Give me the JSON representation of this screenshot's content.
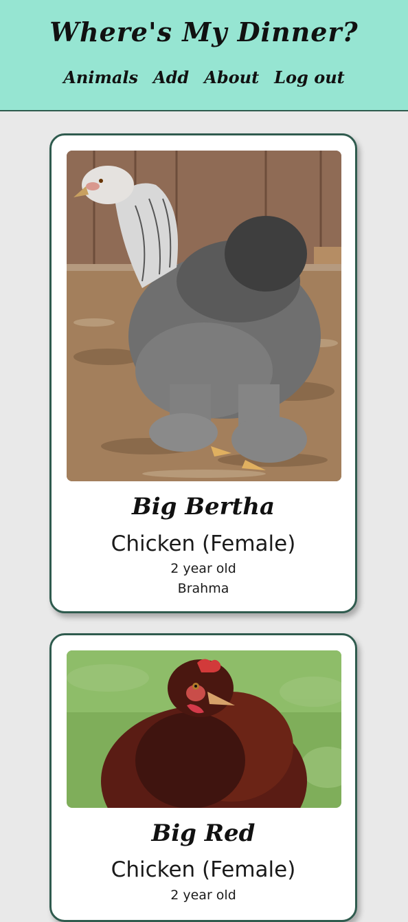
{
  "header": {
    "title": "Where's My Dinner?",
    "nav": [
      "Animals",
      "Add",
      "About",
      "Log out"
    ]
  },
  "animals": [
    {
      "name": "Big Bertha",
      "species": "Chicken (Female)",
      "age": "2 year old",
      "breed": "Brahma"
    },
    {
      "name": "Big Red",
      "species": "Chicken (Female)",
      "age": "2 year old"
    }
  ],
  "colors": {
    "header_bg": "#96e5d2",
    "page_bg": "#e9e9e9",
    "card_border": "#2f5b4e"
  }
}
